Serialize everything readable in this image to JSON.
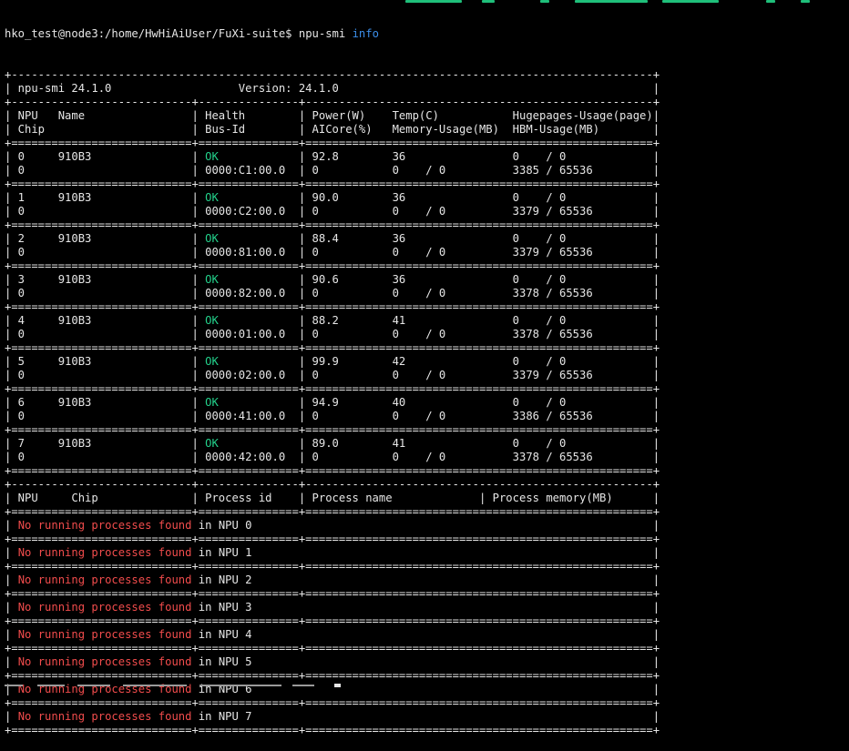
{
  "terminal": {
    "prompt": "hko_test@node3:/home/HwHiAiUser/FuXi-suite$ ",
    "command": "npu-smi",
    "command_arg": "info",
    "colors": {
      "background": "#000000",
      "text": "#e6e6e6",
      "arg": "#3b8eea",
      "ok": "#23d18b",
      "warn": "#f14c4c"
    },
    "lines": [
      [
        {
          "t": "+------------------------------------------------------------------------------------------------+"
        }
      ],
      [
        {
          "t": "| npu-smi 24.1.0                   Version: 24.1.0                                               |"
        }
      ],
      [
        {
          "t": "+---------------------------+---------------+----------------------------------------------------+"
        }
      ],
      [
        {
          "t": "| NPU   Name                | Health        | Power(W)    Temp(C)           Hugepages-Usage(page)|"
        }
      ],
      [
        {
          "t": "| Chip                      | Bus-Id        | AICore(%)   Memory-Usage(MB)  HBM-Usage(MB)        |"
        }
      ],
      [
        {
          "t": "+===========================+===============+====================================================+"
        }
      ],
      [
        {
          "t": "| 0     910B3               | "
        },
        {
          "t": "OK",
          "c": "ok"
        },
        {
          "t": "            | 92.8        36                0    / 0             |"
        }
      ],
      [
        {
          "t": "| 0                         | 0000:C1:00.0  | 0           0    / 0          3385 / 65536         |"
        }
      ],
      [
        {
          "t": "+===========================+===============+====================================================+"
        }
      ],
      [
        {
          "t": "| 1     910B3               | "
        },
        {
          "t": "OK",
          "c": "ok"
        },
        {
          "t": "            | 90.0        36                0    / 0             |"
        }
      ],
      [
        {
          "t": "| 0                         | 0000:C2:00.0  | 0           0    / 0          3379 / 65536         |"
        }
      ],
      [
        {
          "t": "+===========================+===============+====================================================+"
        }
      ],
      [
        {
          "t": "| 2     910B3               | "
        },
        {
          "t": "OK",
          "c": "ok"
        },
        {
          "t": "            | 88.4        36                0    / 0             |"
        }
      ],
      [
        {
          "t": "| 0                         | 0000:81:00.0  | 0           0    / 0          3379 / 65536         |"
        }
      ],
      [
        {
          "t": "+===========================+===============+====================================================+"
        }
      ],
      [
        {
          "t": "| 3     910B3               | "
        },
        {
          "t": "OK",
          "c": "ok"
        },
        {
          "t": "            | 90.6        36                0    / 0             |"
        }
      ],
      [
        {
          "t": "| 0                         | 0000:82:00.0  | 0           0    / 0          3378 / 65536         |"
        }
      ],
      [
        {
          "t": "+===========================+===============+====================================================+"
        }
      ],
      [
        {
          "t": "| 4     910B3               | "
        },
        {
          "t": "OK",
          "c": "ok"
        },
        {
          "t": "            | 88.2        41                0    / 0             |"
        }
      ],
      [
        {
          "t": "| 0                         | 0000:01:00.0  | 0           0    / 0          3378 / 65536         |"
        }
      ],
      [
        {
          "t": "+===========================+===============+====================================================+"
        }
      ],
      [
        {
          "t": "| 5     910B3               | "
        },
        {
          "t": "OK",
          "c": "ok"
        },
        {
          "t": "            | 99.9        42                0    / 0             |"
        }
      ],
      [
        {
          "t": "| 0                         | 0000:02:00.0  | 0           0    / 0          3379 / 65536         |"
        }
      ],
      [
        {
          "t": "+===========================+===============+====================================================+"
        }
      ],
      [
        {
          "t": "| 6     910B3               | "
        },
        {
          "t": "OK",
          "c": "ok"
        },
        {
          "t": "            | 94.9        40                0    / 0             |"
        }
      ],
      [
        {
          "t": "| 0                         | 0000:41:00.0  | 0           0    / 0          3386 / 65536         |"
        }
      ],
      [
        {
          "t": "+===========================+===============+====================================================+"
        }
      ],
      [
        {
          "t": "| 7     910B3               | "
        },
        {
          "t": "OK",
          "c": "ok"
        },
        {
          "t": "            | 89.0        41                0    / 0             |"
        }
      ],
      [
        {
          "t": "| 0                         | 0000:42:00.0  | 0           0    / 0          3378 / 65536         |"
        }
      ],
      [
        {
          "t": "+===========================+===============+====================================================+"
        }
      ],
      [
        {
          "t": "+---------------------------+---------------+----------------------------------------------------+"
        }
      ],
      [
        {
          "t": "| NPU     Chip              | Process id    | Process name             | Process memory(MB)      |"
        }
      ],
      [
        {
          "t": "+===========================+===============+====================================================+"
        }
      ],
      [
        {
          "t": "| "
        },
        {
          "t": "No running processes found",
          "c": "warn"
        },
        {
          "t": " in NPU 0                                                            |"
        }
      ],
      [
        {
          "t": "+===========================+===============+====================================================+"
        }
      ],
      [
        {
          "t": "| "
        },
        {
          "t": "No running processes found",
          "c": "warn"
        },
        {
          "t": " in NPU 1                                                            |"
        }
      ],
      [
        {
          "t": "+===========================+===============+====================================================+"
        }
      ],
      [
        {
          "t": "| "
        },
        {
          "t": "No running processes found",
          "c": "warn"
        },
        {
          "t": " in NPU 2                                                            |"
        }
      ],
      [
        {
          "t": "+===========================+===============+====================================================+"
        }
      ],
      [
        {
          "t": "| "
        },
        {
          "t": "No running processes found",
          "c": "warn"
        },
        {
          "t": " in NPU 3                                                            |"
        }
      ],
      [
        {
          "t": "+===========================+===============+====================================================+"
        }
      ],
      [
        {
          "t": "| "
        },
        {
          "t": "No running processes found",
          "c": "warn"
        },
        {
          "t": " in NPU 4                                                            |"
        }
      ],
      [
        {
          "t": "+===========================+===============+====================================================+"
        }
      ],
      [
        {
          "t": "| "
        },
        {
          "t": "No running processes found",
          "c": "warn"
        },
        {
          "t": " in NPU 5                                                            |"
        }
      ],
      [
        {
          "t": "+===========================+===============+====================================================+"
        }
      ],
      [
        {
          "t": "| "
        },
        {
          "t": "No running processes found",
          "c": "warn"
        },
        {
          "t": " in NPU 6                                                            |"
        }
      ],
      [
        {
          "t": "+===========================+===============+====================================================+"
        }
      ],
      [
        {
          "t": "| "
        },
        {
          "t": "No running processes found",
          "c": "warn"
        },
        {
          "t": " in NPU 7                                                            |"
        }
      ],
      [
        {
          "t": "+===========================+===============+====================================================+"
        }
      ]
    ]
  }
}
